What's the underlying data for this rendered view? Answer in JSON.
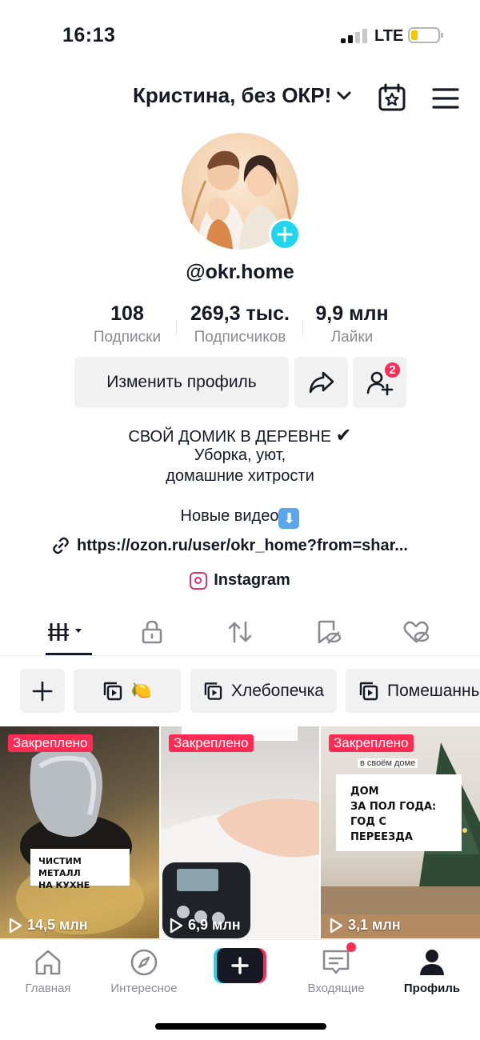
{
  "status_bar": {
    "time": "16:13",
    "network": "LTE",
    "battery_color": "#f4c800"
  },
  "header": {
    "account_name": "Кристина, без ОКР!",
    "chevron_icon": "chevron-down-icon",
    "calendar_icon": "calendar-star-icon",
    "menu_icon": "hamburger-menu-icon"
  },
  "profile": {
    "username": "@okr.home",
    "stats": [
      {
        "value": "108",
        "label": "Подписки"
      },
      {
        "value": "269,3 тыс.",
        "label": "Подписчиков"
      },
      {
        "value": "9,9 млн",
        "label": "Лайки"
      }
    ],
    "edit_button": "Изменить профиль",
    "friend_requests_badge": "2"
  },
  "bio": {
    "line1": "СВОЙ ДОМИК В ДЕРЕВНЕ",
    "line1_check": "✔",
    "line2": "Уборка, уют,",
    "line3": "домашние хитрости",
    "line4": "Новые видео",
    "line4_emoji": "⬇",
    "link": "https://ozon.ru/user/okr_home?from=shar...",
    "instagram": "Instagram"
  },
  "tabs": [
    "videos-grid",
    "private",
    "reposts",
    "favorites",
    "liked"
  ],
  "playlists": [
    {
      "label": "+"
    },
    {
      "label": "🍋"
    },
    {
      "label": "Хлебопечка"
    },
    {
      "label": "Помешанны"
    }
  ],
  "videos": [
    {
      "pinned": "Закреплено",
      "views": "14,5 млн",
      "caption": "ЧИСТИМ МЕТАЛЛ\nНА КУХНЕ"
    },
    {
      "pinned": "Закреплено",
      "views": "6,9 млн",
      "caption": ""
    },
    {
      "pinned": "Закреплено",
      "views": "3,1 млн",
      "caption": "ДОМ\nЗА ПОЛ ГОДА:\nГОД С ПЕРЕЕЗДА",
      "overlay_text": "в своём доме"
    }
  ],
  "bottom_nav": [
    {
      "label": "Главная",
      "icon": "home-icon"
    },
    {
      "label": "Интересное",
      "icon": "compass-icon"
    },
    {
      "label": "",
      "icon": "create-plus-icon"
    },
    {
      "label": "Входящие",
      "icon": "inbox-icon"
    },
    {
      "label": "Профиль",
      "icon": "profile-icon"
    }
  ],
  "colors": {
    "accent_red": "#fe2c55",
    "accent_cyan": "#20d5ec",
    "chip_bg": "#f1f1f2",
    "text_secondary": "#8a8b91"
  }
}
